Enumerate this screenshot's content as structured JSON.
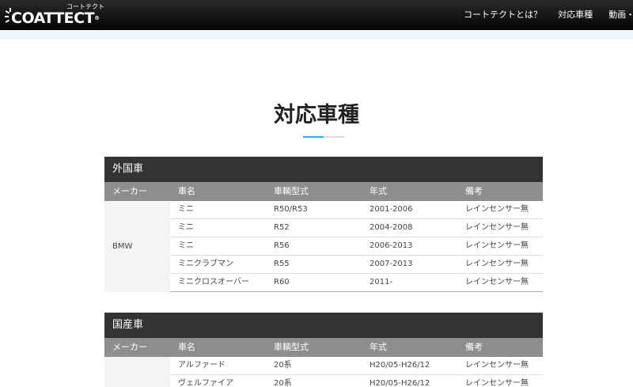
{
  "header": {
    "logo_text": "COATTECT",
    "logo_kana": "コートテクト",
    "logo_mark": "®",
    "nav": [
      {
        "label": "コートテクトとは？"
      },
      {
        "label": "対応車種"
      },
      {
        "label": "動画・リンク"
      }
    ]
  },
  "page": {
    "title": "対応車種"
  },
  "columns": [
    "メーカー",
    "車名",
    "車輌型式",
    "年式",
    "備考"
  ],
  "sections": [
    {
      "title": "外国車",
      "maker": "BMW",
      "rows": [
        [
          "ミニ",
          "R50/R53",
          "2001-2006",
          "レインセンサー無"
        ],
        [
          "ミニ",
          "R52",
          "2004-2008",
          "レインセンサー無"
        ],
        [
          "ミニ",
          "R56",
          "2006-2013",
          "レインセンサー無"
        ],
        [
          "ミニクラブマン",
          "R55",
          "2007-2013",
          "レインセンサー無"
        ],
        [
          "ミニクロスオーバー",
          "R60",
          "2011-",
          "レインセンサー無"
        ]
      ]
    },
    {
      "title": "国産車",
      "maker": "",
      "rows": [
        [
          "アルファード",
          "20系",
          "H20/05-H26/12",
          "レインセンサー無"
        ],
        [
          "ヴェルファイア",
          "20系",
          "H20/05-H26/12",
          "レインセンサー無"
        ]
      ]
    }
  ],
  "colors": {
    "accent": "#2bb1d9",
    "section_header": "#333333",
    "column_header": "#8e8e8e"
  }
}
